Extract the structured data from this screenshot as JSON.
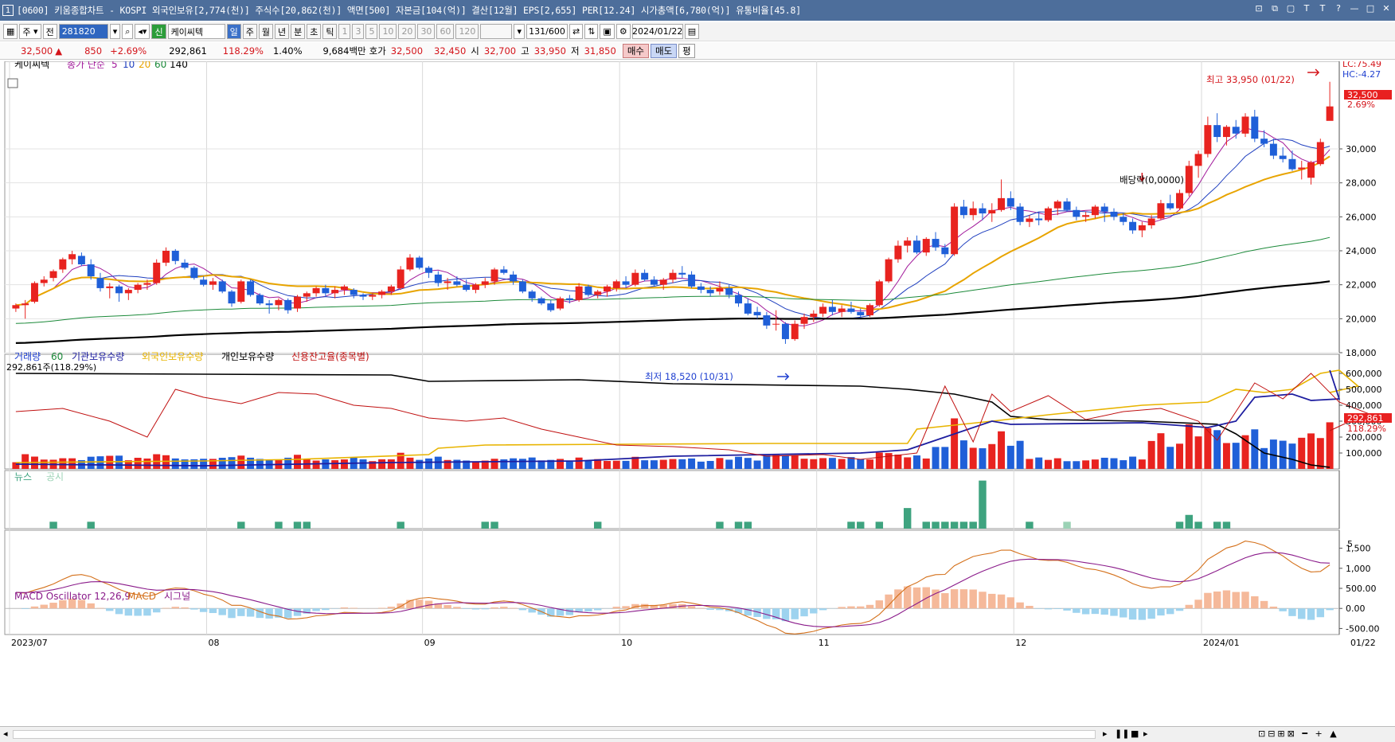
{
  "title_bar": {
    "window_number": "1",
    "text": "[0600] 키움종합차트 - KOSPI 외국인보유[2,774(천)] 주식수[20,862(천)] 액면[500] 자본금[104(억)] 결산[12월] EPS[2,655] PER[12.24] 시가총액[6,780(억)] 유통비율[45.8]"
  },
  "toolbar": {
    "market": "주",
    "prev": "전",
    "code": "281820",
    "market_type": "신",
    "stock_name": "케이씨텍",
    "periods": [
      "일",
      "주",
      "월",
      "년",
      "분",
      "초",
      "틱"
    ],
    "active_period": "일",
    "intervals": [
      "1",
      "3",
      "5",
      "10",
      "20",
      "30",
      "60",
      "120"
    ],
    "count": "131",
    "max_count": "/600",
    "date": "2024/01/22"
  },
  "quote": {
    "price": "32,500",
    "arrow": "▲",
    "change": "850",
    "change_pct": "+2.69%",
    "volume": "292,861",
    "volume_ratio": "118.29%",
    "turnover": "1.40%",
    "amount": "9,684백만",
    "hoga_label": "호가",
    "ask": "32,500",
    "bid": "32,450",
    "open_label": "시",
    "open": "32,700",
    "high_label": "고",
    "high": "33,950",
    "low_label": "저",
    "low": "31,850",
    "buy_label": "매수",
    "sell_label": "매도",
    "avg_label": "평"
  },
  "price_pane": {
    "stock_label": "케이씨텍",
    "ma_label": "종가 단순",
    "ma_periods": [
      "5",
      "10",
      "20",
      "60",
      "140"
    ],
    "ma_colors": [
      "#a21a9b",
      "#1f3fbf",
      "#e8a400",
      "#1c8a3a",
      "#000000"
    ],
    "lc_label": "LC:75.49",
    "hc_label": "HC:-4.27",
    "current_tag": "32,500",
    "current_pct": "2.69%",
    "high_note": "최고 33,950 (01/22)",
    "low_note": "최저 18,520 (10/31)",
    "dividend_note": "배당락(0,0000)",
    "y_ticks": [
      "30,000",
      "28,000",
      "26,000",
      "24,000",
      "22,000",
      "20,000",
      "18,000"
    ]
  },
  "volume_pane": {
    "legend": [
      {
        "text": "거래량",
        "color": "#1e3fd0"
      },
      {
        "text": "60",
        "color": "#1c8a3a"
      },
      {
        "text": "기관보유수량",
        "color": "#1e1ea0"
      },
      {
        "text": "외국인보유수량",
        "color": "#e8b400"
      },
      {
        "text": "개인보유수량",
        "color": "#000000"
      },
      {
        "text": "신용잔고율(종목별)",
        "color": "#c01010"
      }
    ],
    "current_label": "292,861주(118.29%)",
    "tag_value": "292,861",
    "tag_pct": "118.29%",
    "y_ticks": [
      "600,000",
      "500,000",
      "400,000",
      "300,000",
      "200,000",
      "100,000"
    ]
  },
  "news_pane": {
    "label_news": "뉴스",
    "label_disclosure": "공시",
    "y_tick": "5"
  },
  "macd_pane": {
    "label_osc": "MACD Oscillator 12,26,9",
    "label_macd": "MACD",
    "label_signal": "시그널",
    "y_ticks": [
      "1,500",
      "1,000",
      "500.00",
      "0.00",
      "-500.00"
    ]
  },
  "x_axis": {
    "labels": [
      "2023/07",
      "08",
      "09",
      "10",
      "11",
      "12",
      "2024/01"
    ],
    "end_label": "01/22"
  },
  "colors": {
    "up": "#e8231f",
    "down": "#1f5fd8",
    "title_bg": "#4d6e9b",
    "macd_pos": "#f5b99a",
    "macd_neg": "#9ed3ef",
    "news": "#3ea37f"
  },
  "chart_data": {
    "type": "candlestick",
    "dates_start": "2023/07/03",
    "dates_end": "2024/01/22",
    "ohlc": [
      [
        20600,
        20900,
        20400,
        20800
      ],
      [
        20800,
        21100,
        20000,
        20900
      ],
      [
        21000,
        22200,
        20900,
        22100
      ],
      [
        22100,
        22500,
        21900,
        22300
      ],
      [
        22400,
        22900,
        22200,
        22800
      ],
      [
        22900,
        23600,
        22700,
        23500
      ],
      [
        23500,
        24000,
        23200,
        23800
      ],
      [
        23700,
        23900,
        23100,
        23200
      ],
      [
        23200,
        23500,
        22300,
        22500
      ],
      [
        22400,
        22700,
        21600,
        21800
      ],
      [
        21800,
        22100,
        21200,
        21900
      ],
      [
        21900,
        22000,
        21000,
        21500
      ],
      [
        21500,
        21800,
        21100,
        21700
      ],
      [
        21700,
        22100,
        21500,
        22000
      ],
      [
        22000,
        22300,
        21700,
        22100
      ],
      [
        22100,
        23500,
        22000,
        23300
      ],
      [
        23300,
        24200,
        23100,
        24000
      ],
      [
        24000,
        24100,
        23200,
        23400
      ],
      [
        23300,
        23500,
        22900,
        23000
      ],
      [
        23000,
        23100,
        22300,
        22400
      ],
      [
        22300,
        22500,
        21900,
        22000
      ],
      [
        22000,
        22400,
        21700,
        22200
      ],
      [
        22200,
        22300,
        21500,
        21600
      ],
      [
        21600,
        21700,
        20700,
        20900
      ],
      [
        21000,
        22300,
        20900,
        22200
      ],
      [
        22200,
        22300,
        21300,
        21400
      ],
      [
        21400,
        21500,
        20800,
        20900
      ],
      [
        20900,
        21100,
        20300,
        20800
      ],
      [
        20800,
        21200,
        20500,
        21100
      ],
      [
        21100,
        21200,
        20300,
        20500
      ],
      [
        20600,
        21400,
        20400,
        21300
      ],
      [
        21300,
        21600,
        21000,
        21500
      ],
      [
        21500,
        21900,
        21300,
        21800
      ],
      [
        21800,
        22000,
        21300,
        21500
      ],
      [
        21500,
        21900,
        21200,
        21700
      ],
      [
        21700,
        22000,
        21400,
        21900
      ],
      [
        21700,
        21800,
        21200,
        21400
      ],
      [
        21400,
        21500,
        21100,
        21300
      ],
      [
        21300,
        21500,
        21100,
        21400
      ],
      [
        21400,
        21700,
        21200,
        21600
      ],
      [
        21600,
        22000,
        21400,
        21900
      ],
      [
        21800,
        23100,
        21700,
        22900
      ],
      [
        22900,
        23800,
        22800,
        23600
      ],
      [
        23600,
        23700,
        22900,
        23000
      ],
      [
        23000,
        23100,
        22400,
        22700
      ],
      [
        22600,
        22800,
        21900,
        22100
      ],
      [
        22100,
        22400,
        21700,
        22200
      ],
      [
        22200,
        22500,
        21900,
        22000
      ],
      [
        22000,
        22300,
        21600,
        21700
      ],
      [
        21700,
        22100,
        21500,
        22000
      ],
      [
        22000,
        22400,
        21800,
        22200
      ],
      [
        22200,
        23000,
        22000,
        22900
      ],
      [
        22900,
        23100,
        22600,
        22700
      ],
      [
        22600,
        22800,
        22000,
        22200
      ],
      [
        22200,
        22300,
        21500,
        21600
      ],
      [
        21600,
        21700,
        21000,
        21200
      ],
      [
        21200,
        21300,
        20800,
        20900
      ],
      [
        20900,
        21100,
        20400,
        20500
      ],
      [
        20600,
        21300,
        20500,
        21200
      ],
      [
        21200,
        21400,
        20900,
        21100
      ],
      [
        21100,
        22100,
        21000,
        21900
      ],
      [
        21900,
        22000,
        21300,
        21400
      ],
      [
        21400,
        21700,
        21200,
        21600
      ],
      [
        21600,
        22000,
        21300,
        21900
      ],
      [
        21800,
        22300,
        21600,
        22200
      ],
      [
        22200,
        22500,
        21800,
        22000
      ],
      [
        22000,
        22900,
        21900,
        22700
      ],
      [
        22700,
        22900,
        22200,
        22300
      ],
      [
        22300,
        22500,
        21900,
        22000
      ],
      [
        22000,
        22400,
        21700,
        22300
      ],
      [
        22300,
        22900,
        22100,
        22700
      ],
      [
        22700,
        23100,
        22400,
        22600
      ],
      [
        22600,
        22800,
        21800,
        21900
      ],
      [
        21900,
        22100,
        21500,
        21700
      ],
      [
        21700,
        21900,
        21300,
        21500
      ],
      [
        21600,
        22200,
        21400,
        21800
      ],
      [
        21800,
        22000,
        21200,
        21400
      ],
      [
        21400,
        21600,
        20700,
        20900
      ],
      [
        20900,
        21200,
        20200,
        20300
      ],
      [
        20400,
        20700,
        20000,
        20200
      ],
      [
        20200,
        20400,
        19400,
        19600
      ],
      [
        19700,
        20500,
        19300,
        19700
      ],
      [
        19700,
        19800,
        18520,
        18800
      ],
      [
        18800,
        19900,
        18700,
        19700
      ],
      [
        19700,
        20300,
        19400,
        20100
      ],
      [
        20100,
        20500,
        19800,
        20300
      ],
      [
        20300,
        20900,
        20100,
        20700
      ],
      [
        20700,
        21100,
        20200,
        20400
      ],
      [
        20400,
        20800,
        20100,
        20600
      ],
      [
        20600,
        21000,
        20300,
        20400
      ],
      [
        20400,
        20600,
        20100,
        20200
      ],
      [
        20200,
        20900,
        20100,
        20800
      ],
      [
        20800,
        22300,
        20700,
        22200
      ],
      [
        22200,
        23600,
        22100,
        23500
      ],
      [
        23500,
        24600,
        23300,
        24300
      ],
      [
        24300,
        24800,
        23900,
        24600
      ],
      [
        24600,
        24900,
        23800,
        23900
      ],
      [
        23900,
        24800,
        23700,
        24700
      ],
      [
        24700,
        25100,
        24000,
        24200
      ],
      [
        24200,
        24400,
        23600,
        23800
      ],
      [
        23800,
        26800,
        23700,
        26600
      ],
      [
        26600,
        27000,
        25900,
        26100
      ],
      [
        26100,
        26900,
        25800,
        26500
      ],
      [
        26500,
        26800,
        25800,
        26200
      ],
      [
        26200,
        26800,
        25700,
        26400
      ],
      [
        26400,
        28200,
        26300,
        27100
      ],
      [
        27100,
        27500,
        26400,
        26600
      ],
      [
        26600,
        26800,
        25500,
        25700
      ],
      [
        25700,
        26100,
        25400,
        25900
      ],
      [
        25900,
        26300,
        25500,
        25800
      ],
      [
        25800,
        26600,
        25700,
        26500
      ],
      [
        26500,
        27000,
        26100,
        26900
      ],
      [
        26900,
        27100,
        26300,
        26400
      ],
      [
        26400,
        26600,
        25800,
        26000
      ],
      [
        26000,
        26300,
        25700,
        26100
      ],
      [
        26100,
        26700,
        25900,
        26600
      ],
      [
        26600,
        26800,
        25700,
        26300
      ],
      [
        26300,
        26500,
        25800,
        26000
      ],
      [
        26000,
        26200,
        25500,
        25700
      ],
      [
        25700,
        25900,
        25000,
        25200
      ],
      [
        25200,
        25700,
        24800,
        25500
      ],
      [
        25500,
        26100,
        25300,
        25900
      ],
      [
        25900,
        27000,
        25800,
        26800
      ],
      [
        26800,
        27300,
        26400,
        26500
      ],
      [
        26500,
        27600,
        26400,
        27400
      ],
      [
        27400,
        29300,
        27200,
        29000
      ],
      [
        29000,
        29900,
        28300,
        29700
      ],
      [
        29700,
        31900,
        29500,
        31400
      ],
      [
        31400,
        32100,
        30400,
        30700
      ],
      [
        30700,
        31400,
        30200,
        31300
      ],
      [
        31300,
        31700,
        30600,
        30900
      ],
      [
        30900,
        32100,
        30700,
        31900
      ],
      [
        31900,
        32300,
        30400,
        30600
      ],
      [
        30600,
        31100,
        30100,
        30300
      ],
      [
        30300,
        30600,
        29400,
        29600
      ],
      [
        29600,
        30100,
        29200,
        29400
      ],
      [
        29400,
        29900,
        28700,
        28800
      ],
      [
        28800,
        29300,
        28200,
        28900
      ],
      [
        28300,
        29300,
        27900,
        29200
      ],
      [
        29100,
        30600,
        29000,
        30400
      ],
      [
        31650,
        33950,
        31850,
        32500
      ]
    ],
    "x_start_label": "2023/07",
    "x_end_label": "01/22",
    "y_range": [
      18000,
      34500
    ]
  }
}
